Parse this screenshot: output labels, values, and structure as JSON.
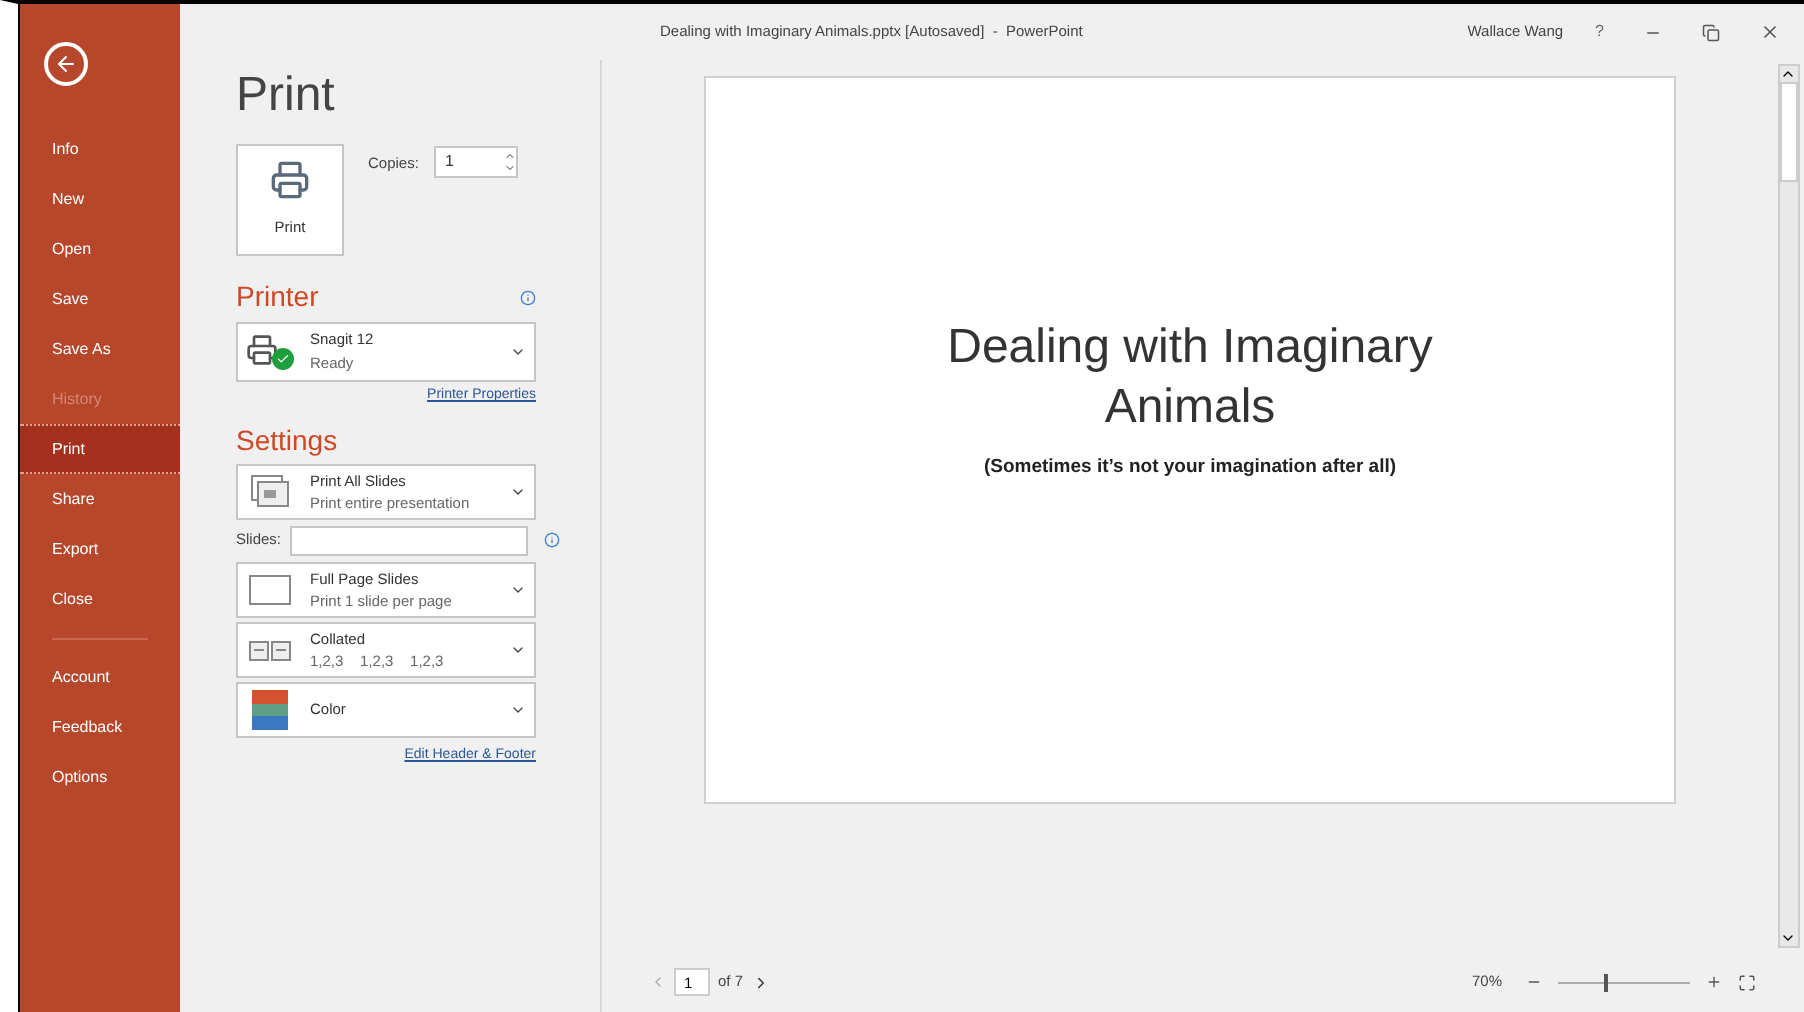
{
  "window": {
    "title": "Dealing with Imaginary Animals.pptx [Autosaved]  -  PowerPoint",
    "user": "Wallace Wang",
    "help": "?"
  },
  "sidebar": {
    "items": [
      {
        "label": "Info",
        "selected": false,
        "disabled": false
      },
      {
        "label": "New",
        "selected": false,
        "disabled": false
      },
      {
        "label": "Open",
        "selected": false,
        "disabled": false
      },
      {
        "label": "Save",
        "selected": false,
        "disabled": false
      },
      {
        "label": "Save As",
        "selected": false,
        "disabled": false
      },
      {
        "label": "History",
        "selected": false,
        "disabled": true
      },
      {
        "label": "Print",
        "selected": true,
        "disabled": false
      },
      {
        "label": "Share",
        "selected": false,
        "disabled": false
      },
      {
        "label": "Export",
        "selected": false,
        "disabled": false
      },
      {
        "label": "Close",
        "selected": false,
        "disabled": false
      }
    ],
    "bottom_items": [
      {
        "label": "Account",
        "selected": false,
        "disabled": false
      },
      {
        "label": "Feedback",
        "selected": false,
        "disabled": false
      },
      {
        "label": "Options",
        "selected": false,
        "disabled": false
      }
    ]
  },
  "page_title": "Print",
  "print_button": "Print",
  "copies": {
    "label": "Copies:",
    "value": "1"
  },
  "printer": {
    "heading": "Printer",
    "name": "Snagit 12",
    "status": "Ready",
    "properties_link": "Printer Properties"
  },
  "settings": {
    "heading": "Settings",
    "slides_field": {
      "label": "Slides:"
    },
    "options": [
      {
        "kind": "slides",
        "title": "Print All Slides",
        "subtitle": "Print entire presentation"
      },
      {
        "kind": "layout",
        "title": "Full Page Slides",
        "subtitle": "Print 1 slide per page"
      },
      {
        "kind": "collate",
        "title": "Collated",
        "subtitle": "1,2,3    1,2,3    1,2,3"
      },
      {
        "kind": "color",
        "title": "Color"
      }
    ],
    "header_footer_link": "Edit Header & Footer"
  },
  "preview": {
    "title": "Dealing with Imaginary Animals",
    "subtitle": "(Sometimes it’s not your imagination after all)"
  },
  "pager": {
    "page": "1",
    "of": "of 7"
  },
  "zoom": {
    "reading": "70%",
    "level": 0.35
  }
}
